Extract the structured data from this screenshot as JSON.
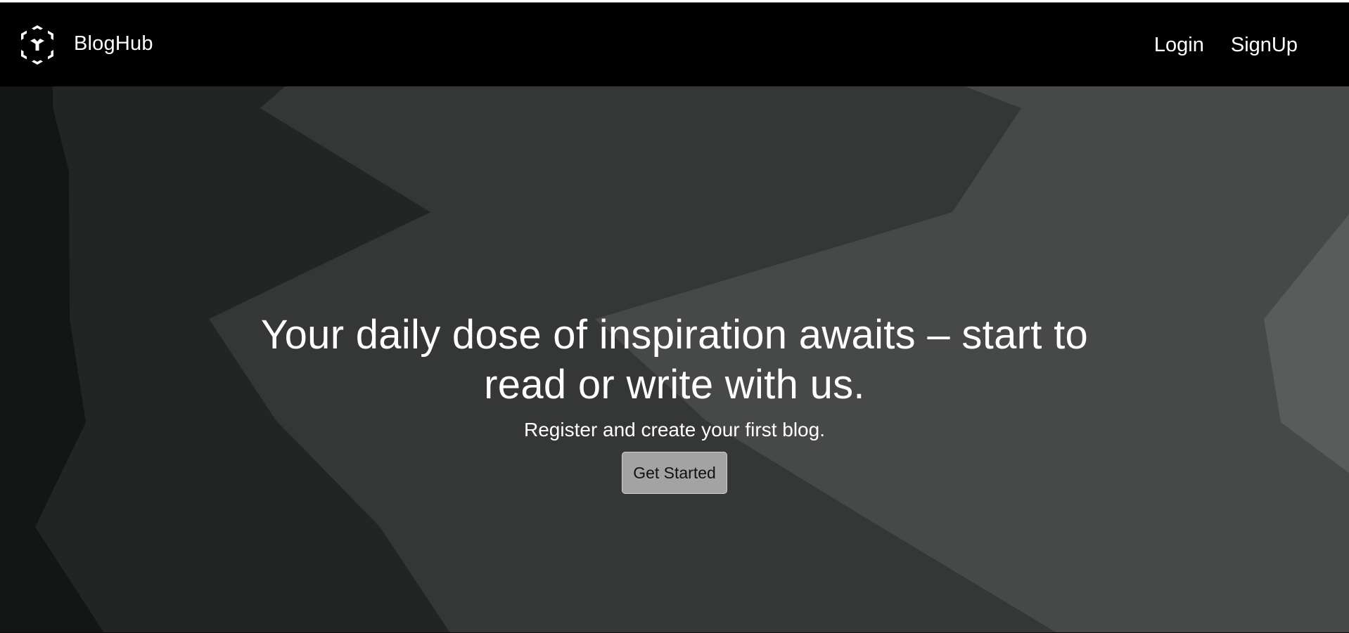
{
  "brand": {
    "name": "BlogHub",
    "logo_icon": "hexagon-cube-logo-icon"
  },
  "nav": {
    "login": "Login",
    "signup": "SignUp"
  },
  "hero": {
    "headline": "Your daily dose of inspiration awaits – start to read or write with us.",
    "subtitle": "Register and create your first blog.",
    "cta_label": "Get Started"
  },
  "colors": {
    "navbar_bg": "#000000",
    "text": "#ffffff",
    "cta_bg": "#a3a3a3",
    "bg_shades": [
      "#141515",
      "#232424",
      "#353636",
      "#474949",
      "#5a5c5c"
    ]
  }
}
